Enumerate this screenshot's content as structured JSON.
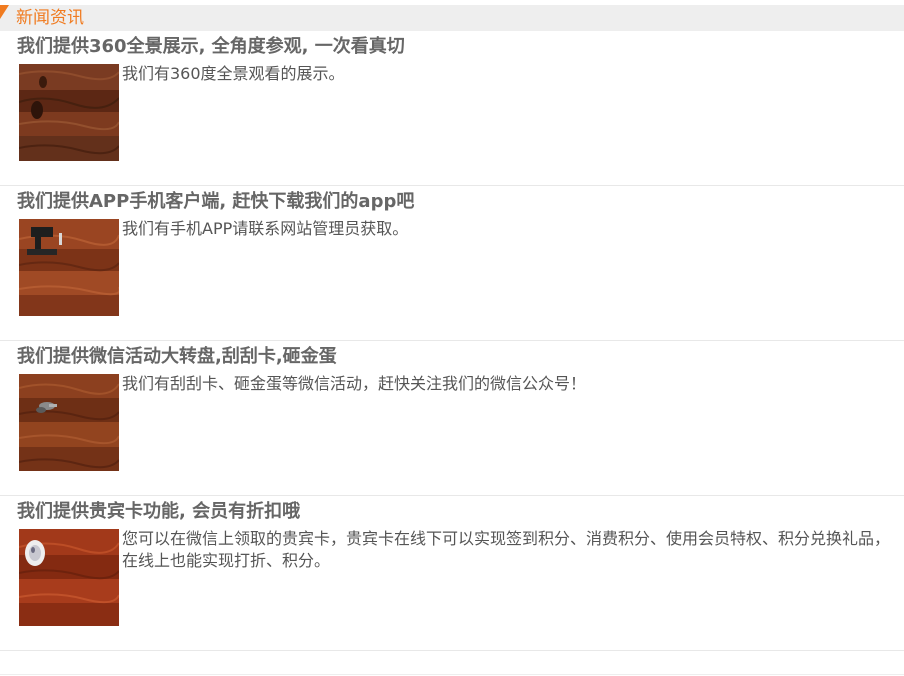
{
  "header": {
    "title": "新闻资讯",
    "accent_color": "#f07b20"
  },
  "news": [
    {
      "title": "我们提供360全景展示, 全角度参观, 一次看真切",
      "summary": "我们有360度全景观看的展示。",
      "thumbnail": "wood-floor-photo"
    },
    {
      "title": "我们提供APP手机客户端, 赶快下载我们的app吧",
      "summary": "我们有手机APP请联系网站管理员获取。",
      "thumbnail": "wood-floor-with-machine-photo"
    },
    {
      "title": "我们提供微信活动大转盘,刮刮卡,砸金蛋",
      "summary": "我们有刮刮卡、砸金蛋等微信活动，赶快关注我们的微信公众号！",
      "thumbnail": "wood-floor-with-keys-photo"
    },
    {
      "title": "我们提供贵宾卡功能, 会员有折扣哦",
      "summary": "您可以在微信上领取的贵宾卡，贵宾卡在线下可以实现签到积分、消费积分、使用会员特权、积分兑换礼品，在线上也能实现打折、积分。",
      "thumbnail": "wood-floor-with-cup-photo"
    }
  ]
}
